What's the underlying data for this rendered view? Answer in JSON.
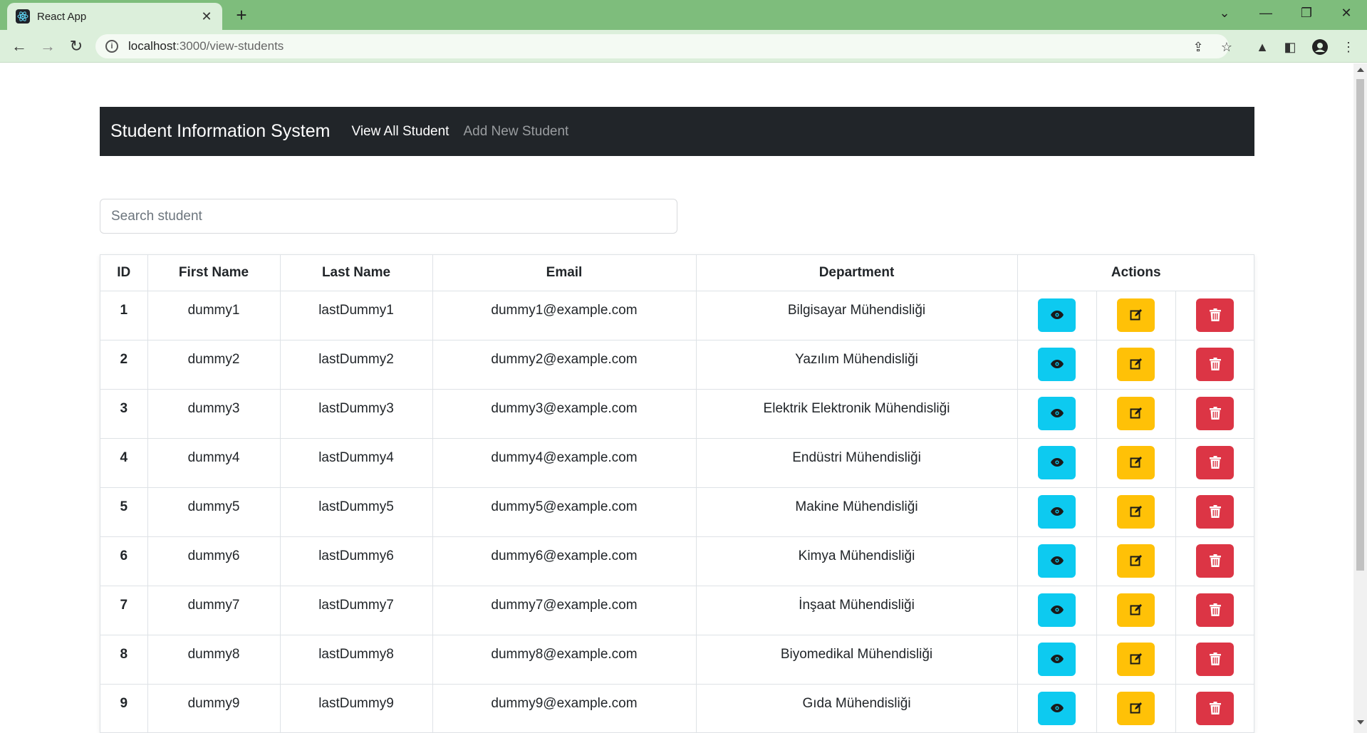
{
  "browser": {
    "tab_title": "React App",
    "url_host": "localhost",
    "url_path": ":3000/view-students"
  },
  "navbar": {
    "brand": "Student Information System",
    "links": [
      "View All Student",
      "Add New Student"
    ]
  },
  "search": {
    "placeholder": "Search student"
  },
  "table": {
    "headers": [
      "ID",
      "First Name",
      "Last Name",
      "Email",
      "Department",
      "Actions"
    ],
    "rows": [
      {
        "id": "1",
        "first": "dummy1",
        "last": "lastDummy1",
        "email": "dummy1@example.com",
        "dept": "Bilgisayar Mühendisliği"
      },
      {
        "id": "2",
        "first": "dummy2",
        "last": "lastDummy2",
        "email": "dummy2@example.com",
        "dept": "Yazılım Mühendisliği"
      },
      {
        "id": "3",
        "first": "dummy3",
        "last": "lastDummy3",
        "email": "dummy3@example.com",
        "dept": "Elektrik Elektronik Mühendisliği"
      },
      {
        "id": "4",
        "first": "dummy4",
        "last": "lastDummy4",
        "email": "dummy4@example.com",
        "dept": "Endüstri Mühendisliği"
      },
      {
        "id": "5",
        "first": "dummy5",
        "last": "lastDummy5",
        "email": "dummy5@example.com",
        "dept": "Makine Mühendisliği"
      },
      {
        "id": "6",
        "first": "dummy6",
        "last": "lastDummy6",
        "email": "dummy6@example.com",
        "dept": "Kimya Mühendisliği"
      },
      {
        "id": "7",
        "first": "dummy7",
        "last": "lastDummy7",
        "email": "dummy7@example.com",
        "dept": "İnşaat Mühendisliği"
      },
      {
        "id": "8",
        "first": "dummy8",
        "last": "lastDummy8",
        "email": "dummy8@example.com",
        "dept": "Biyomedikal Mühendisliği"
      },
      {
        "id": "9",
        "first": "dummy9",
        "last": "lastDummy9",
        "email": "dummy9@example.com",
        "dept": "Gıda Mühendisliği"
      }
    ]
  },
  "colors": {
    "view": "#0dcaf0",
    "edit": "#ffc107",
    "delete": "#dc3545",
    "navbar": "#212529"
  }
}
